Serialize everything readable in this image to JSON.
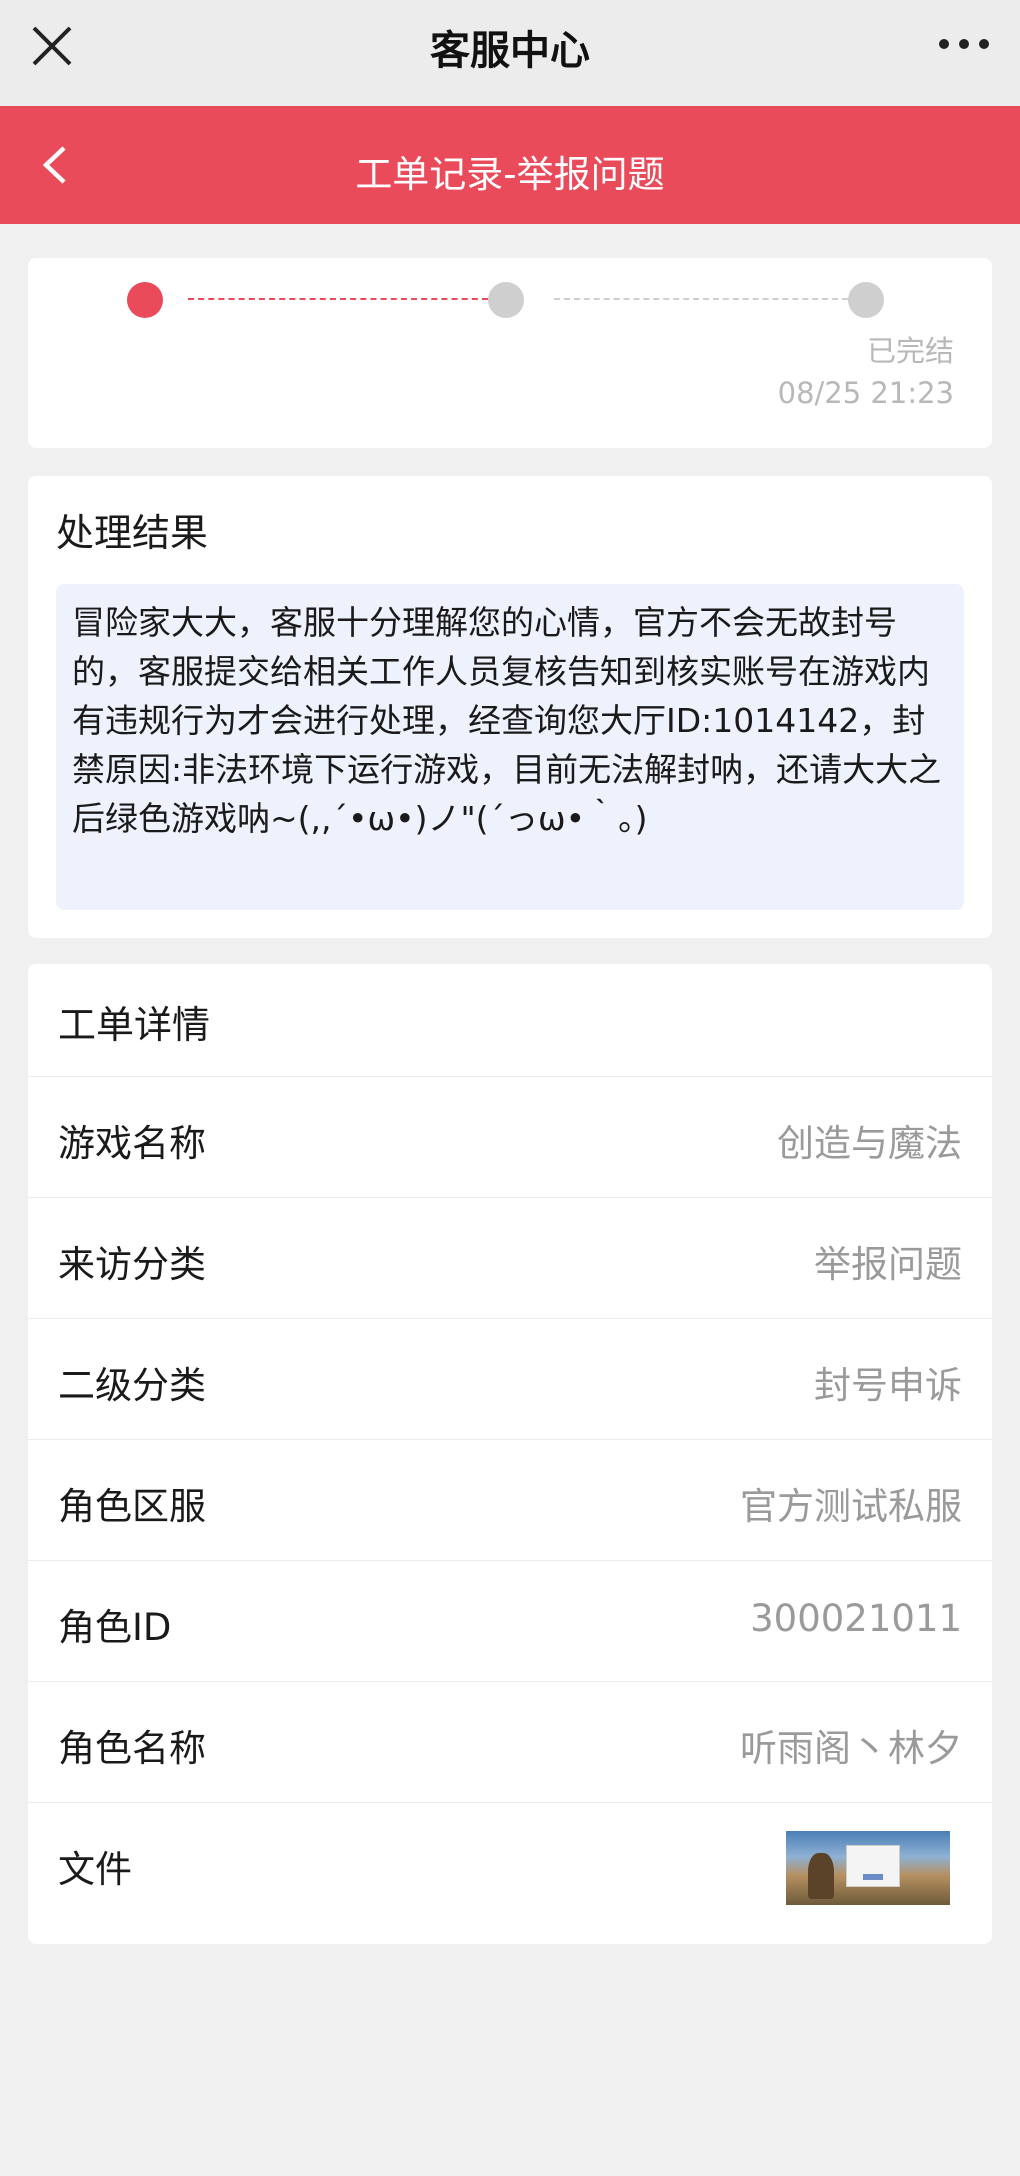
{
  "topbar": {
    "title": "客服中心"
  },
  "header": {
    "title": "工单记录-举报问题"
  },
  "progress": {
    "steps": [
      {
        "active": true
      },
      {
        "active": false
      },
      {
        "active": false
      }
    ],
    "final_label": "已完结",
    "final_time": "08/25 21:23"
  },
  "result": {
    "title": "处理结果",
    "text": "冒险家大大，客服十分理解您的心情，官方不会无故封号的，客服提交给相关工作人员复核告知到核实账号在游戏内有违规行为才会进行处理，经查询您大厅ID:1014142，封禁原因:非法环境下运行游戏，目前无法解封呐，还请大大之后绿色游戏呐~(,,´•ω•)ノ\"(´っω•｀。)"
  },
  "details": {
    "title": "工单详情",
    "rows": [
      {
        "label": "游戏名称",
        "value": "创造与魔法"
      },
      {
        "label": "来访分类",
        "value": "举报问题"
      },
      {
        "label": "二级分类",
        "value": "封号申诉"
      },
      {
        "label": "角色区服",
        "value": "官方测试私服"
      },
      {
        "label": "角色ID",
        "value": "300021011"
      },
      {
        "label": "角色名称",
        "value": "听雨阁丶林夕"
      }
    ],
    "file_label": "文件"
  },
  "colors": {
    "accent": "#e94b5b",
    "inactive": "#cfcfcf",
    "result_bg": "#eef2fc"
  },
  "icons": [
    "close-icon",
    "more-icon",
    "back-chevron-icon",
    "file-thumbnail"
  ]
}
